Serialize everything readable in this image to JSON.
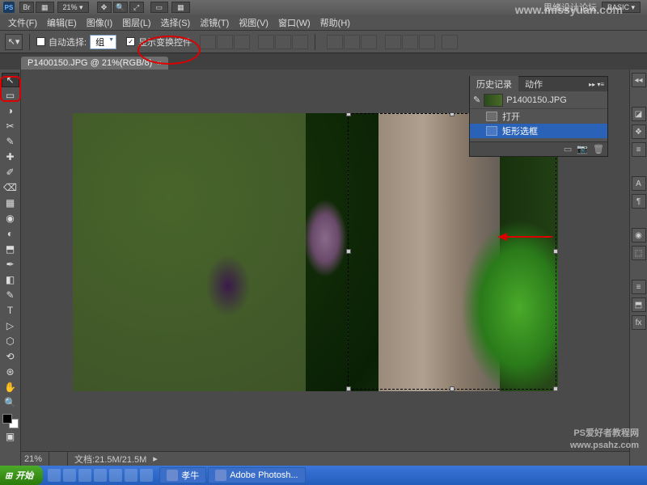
{
  "titlebar": {
    "logo": "PS",
    "zoom": "21% ▾",
    "workspace": "思绪设计论坛",
    "basic": "BASIC ▾",
    "nav_icons": [
      "Br",
      "▦",
      "⤢",
      "✥",
      "🔍",
      "▭",
      "▦"
    ]
  },
  "menu": [
    "文件(F)",
    "编辑(E)",
    "图像(I)",
    "图层(L)",
    "选择(S)",
    "滤镜(T)",
    "视图(V)",
    "窗口(W)",
    "帮助(H)"
  ],
  "options": {
    "auto_select_label": "自动选择:",
    "auto_select_value": "组",
    "show_transform_label": "显示变换控件",
    "show_transform_checked": "✓"
  },
  "doctab": {
    "title": "P1400150.JPG @ 21%(RGB/8)",
    "close": "×"
  },
  "tools": [
    "↖",
    "▭",
    "◑",
    "✂",
    "✎",
    "✚",
    "✐",
    "⌫",
    "▦",
    "◉",
    "◐",
    "⬒",
    "✒",
    "◧",
    "T",
    "▷",
    "⬡",
    "✋",
    "🔍"
  ],
  "right_icons": [
    "◪",
    "❖",
    "≡",
    "A",
    "⬚",
    "¶",
    "fx",
    "≡",
    "◧",
    "◉",
    "⬒",
    "▭"
  ],
  "history": {
    "tab1": "历史记录",
    "tab2": "动作",
    "menu": "▸▸  ▾≡",
    "snapshot": "P1400150.JPG",
    "rows": [
      {
        "label": "打开",
        "sel": false
      },
      {
        "label": "矩形选框",
        "sel": true
      }
    ],
    "footer_icons": [
      "▭",
      "📷",
      "🗑"
    ]
  },
  "status": {
    "zoom": "21%",
    "docinfo": "文档:21.5M/21.5M",
    "arrow": "▸"
  },
  "taskbar": {
    "start": "开始",
    "tasks": [
      {
        "label": "孝牛"
      },
      {
        "label": "Adobe Photosh..."
      }
    ]
  },
  "watermarks": {
    "top": "www.missyuan.com",
    "bottom_line1": "PS爱好者教程网",
    "bottom_line2": "www.psahz.com"
  },
  "colors": {
    "accent": "#2a62b8",
    "red": "#d00"
  }
}
